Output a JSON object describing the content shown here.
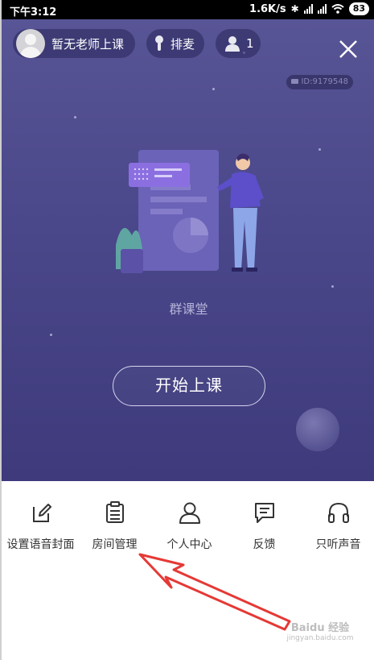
{
  "status_bar": {
    "time": "下午3:12",
    "net_speed": "1.6K/s",
    "battery": "83"
  },
  "header": {
    "host_label": "暂无老师上课",
    "queue_label": "排麦",
    "member_count": "1",
    "room_id": "ID:9179548"
  },
  "main": {
    "subtitle": "群课堂",
    "start_button": "开始上课"
  },
  "toolbar": {
    "items": [
      {
        "label": "设置语音封面",
        "icon": "edit-icon"
      },
      {
        "label": "房间管理",
        "icon": "clipboard-icon"
      },
      {
        "label": "个人中心",
        "icon": "person-icon"
      },
      {
        "label": "反馈",
        "icon": "message-icon"
      },
      {
        "label": "只听声音",
        "icon": "headphones-icon"
      }
    ]
  },
  "watermark": {
    "text": "Baidu 经验",
    "url": "jingyan.baidu.com"
  },
  "colors": {
    "stage_bg": "#4a478a",
    "accent_purple": "#5c4fc9",
    "arrow": "#e53935",
    "icon": "#333333"
  }
}
